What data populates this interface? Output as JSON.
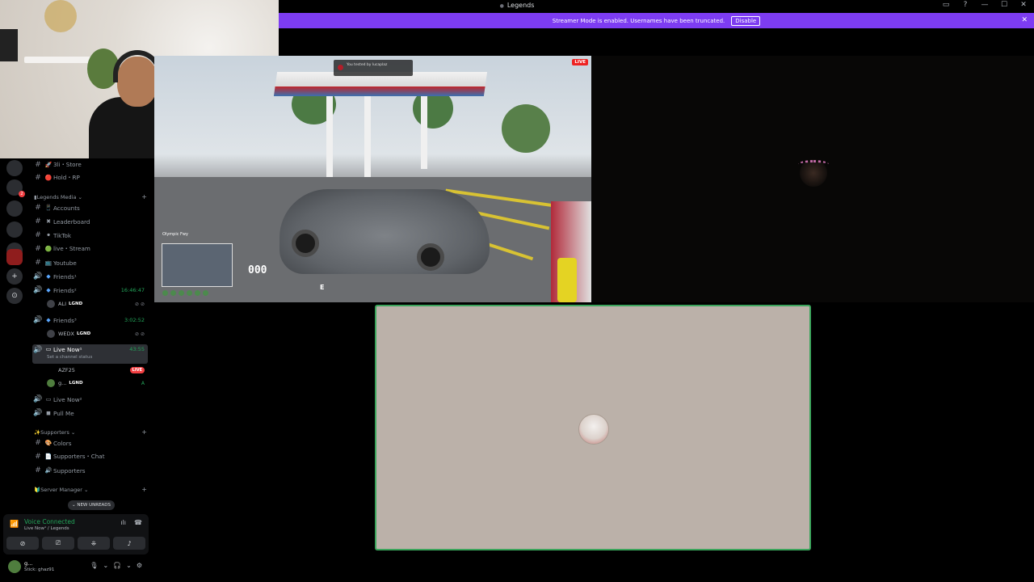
{
  "window": {
    "title": "Legends"
  },
  "banner": {
    "message": "Streamer Mode is enabled. Usernames have been truncated.",
    "disable_label": "Disable"
  },
  "servers": [
    {
      "label": "",
      "badge": ""
    },
    {
      "label": "",
      "badge": "2"
    },
    {
      "label": "",
      "badge": ""
    },
    {
      "label": "",
      "badge": ""
    },
    {
      "label": "",
      "badge": ""
    },
    {
      "label": "",
      "badge": ""
    },
    {
      "label": "",
      "badge": ""
    }
  ],
  "channels": {
    "top": [
      {
        "emoji": "🚀",
        "name": "3li・Store"
      },
      {
        "emoji": "🔴",
        "name": "Hold・RP"
      }
    ],
    "legends_media": {
      "label": "Legends Media",
      "items": [
        {
          "emoji": "📱",
          "name": "Accounts"
        },
        {
          "emoji": "✖",
          "name": "Leaderboard"
        },
        {
          "emoji": "⚫",
          "name": "TikTok"
        },
        {
          "emoji": "🟢",
          "name": "live・Stream"
        },
        {
          "emoji": "📺",
          "name": "Youtube"
        }
      ]
    },
    "voice": [
      {
        "name": "Friends¹",
        "time": ""
      },
      {
        "name": "Friends²",
        "time": "16:46:47"
      },
      {
        "name": "Friends³",
        "time": "3:02:52"
      },
      {
        "name": "Live Now¹",
        "time": "43:55",
        "status": "Set a channel status"
      },
      {
        "name": "Live Now²",
        "time": ""
      },
      {
        "name": "Pull Me",
        "time": ""
      }
    ],
    "users_friends2": [
      {
        "name": "ALI",
        "tag": "LGND"
      }
    ],
    "users_friends3": [
      {
        "name": "WEDX",
        "tag": "LGND"
      }
    ],
    "users_live1": [
      {
        "name": "AZF25",
        "tag": "",
        "live": "LIVE",
        "end": ""
      },
      {
        "name": "g...",
        "tag": "LGND",
        "live": "",
        "end": "A"
      }
    ],
    "supporters": {
      "label": "Supporters",
      "items": [
        {
          "emoji": "🎨",
          "name": "Colors"
        },
        {
          "emoji": "📄",
          "name": "Supporters・Chat"
        },
        {
          "emoji": "🔊",
          "name": "Supporters"
        }
      ]
    },
    "server_manager": {
      "label": "Server Manager"
    }
  },
  "new_unreads": "NEW UNREADS",
  "voice_panel": {
    "title": "Voice Connected",
    "subtitle": "Live Now¹ / Legends"
  },
  "user_panel": {
    "name": "g...",
    "status": "Stick: ghaz91"
  },
  "game": {
    "notification": "You tested by lucaplaz",
    "live_badge": "LIVE",
    "location": "Olympic Fwy",
    "speed": "000",
    "gear": "E"
  },
  "colors": {
    "banner": "#7d3cf2",
    "voice_green": "#23a55a",
    "speaking_border": "#3ba55c",
    "live_red": "#f23f42"
  }
}
